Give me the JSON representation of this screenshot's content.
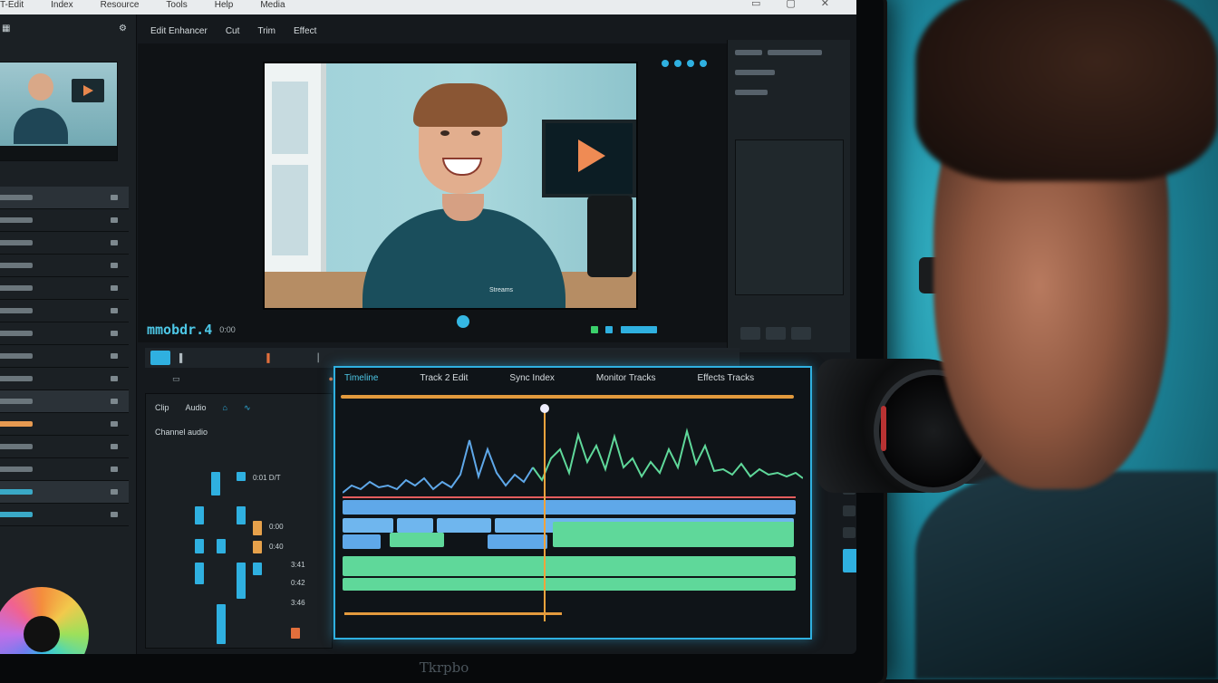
{
  "menubar": {
    "items": [
      "T-Edit",
      "Index",
      "Resource",
      "Tools",
      "Help",
      "Media"
    ]
  },
  "toolbar": {
    "tabs": [
      "Edit Enhancer",
      "Cut",
      "Trim",
      "Effect"
    ]
  },
  "viewer": {
    "title": "mmobdr.4",
    "subtitle": "0:00",
    "shirt_text": "Streams"
  },
  "mixer": {
    "tabs": [
      "Clip",
      "Audio"
    ],
    "subtitle": "Channel audio",
    "labels": [
      "0:01 D/T",
      "0:00",
      "0:40",
      "3:41",
      "0:42",
      "3:46"
    ]
  },
  "timeline": {
    "headers": [
      "Timeline",
      "Track 2 Edit",
      "Sync Index",
      "Monitor Tracks",
      "Effects Tracks"
    ]
  },
  "monitor": {
    "brand": "Tkrpbo"
  },
  "colors": {
    "accent": "#2fb0e0",
    "audio_wave_blue": "#5fa8e9",
    "audio_wave_green": "#5fd89a",
    "playhead": "#f0a33d",
    "record_led": "#34e06a"
  }
}
